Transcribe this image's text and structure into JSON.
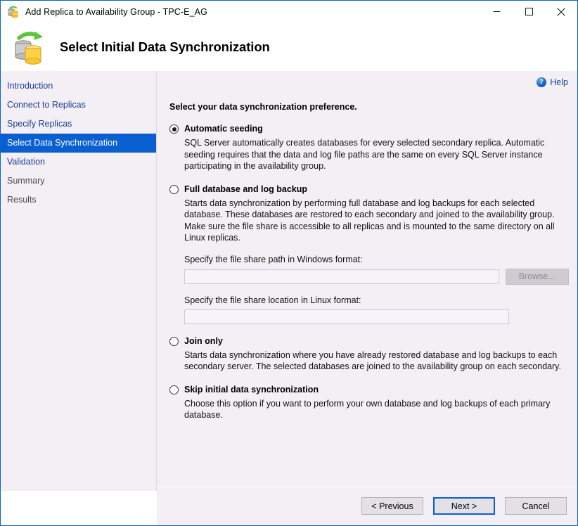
{
  "window": {
    "title": "Add Replica to Availability Group - TPC-E_AG",
    "icon": "database-sync-icon",
    "controls": {
      "minimize": "minimize-icon",
      "maximize": "maximize-icon",
      "close": "close-icon"
    }
  },
  "header": {
    "title": "Select Initial Data Synchronization",
    "icon": "database-sync-icon"
  },
  "sidebar": {
    "items": [
      {
        "label": "Introduction",
        "state": "link"
      },
      {
        "label": "Connect to Replicas",
        "state": "link"
      },
      {
        "label": "Specify Replicas",
        "state": "link"
      },
      {
        "label": "Select Data Synchronization",
        "state": "selected"
      },
      {
        "label": "Validation",
        "state": "link"
      },
      {
        "label": "Summary",
        "state": "disabled"
      },
      {
        "label": "Results",
        "state": "disabled"
      }
    ]
  },
  "content": {
    "help": {
      "label": "Help",
      "icon": "help-circle-icon"
    },
    "section_title": "Select your data synchronization preference.",
    "options": [
      {
        "label": "Automatic seeding",
        "selected": true,
        "description": "SQL Server automatically creates databases for every selected secondary replica. Automatic seeding requires that the data and log file paths are the same on every SQL Server instance participating in the availability group."
      },
      {
        "label": "Full database and log backup",
        "selected": false,
        "description": "Starts data synchronization by performing full database and log backups for each selected database. These databases are restored to each secondary and joined to the availability group. Make sure the file share is accessible to all replicas and is mounted to the same directory on all Linux replicas."
      },
      {
        "label": "Join only",
        "selected": false,
        "description": "Starts data synchronization where you have already restored database and log backups to each secondary server. The selected databases are joined to the availability group on each secondary."
      },
      {
        "label": "Skip initial data synchronization",
        "selected": false,
        "description": "Choose this option if you want to perform your own database and log backups of each primary database."
      }
    ],
    "windows_path": {
      "label": "Specify the file share path in Windows format:",
      "value": "",
      "placeholder": ""
    },
    "linux_path": {
      "label": "Specify the file share location in Linux format:",
      "value": "",
      "placeholder": ""
    },
    "browse_label": "Browse..."
  },
  "footer": {
    "previous_label": "< Previous",
    "next_label": "Next >",
    "cancel_label": "Cancel"
  },
  "colors": {
    "accent": "#0a5fd0",
    "panel": "#f3eff5",
    "link": "#1b3f94",
    "disabled_text": "#4e4a4a"
  }
}
